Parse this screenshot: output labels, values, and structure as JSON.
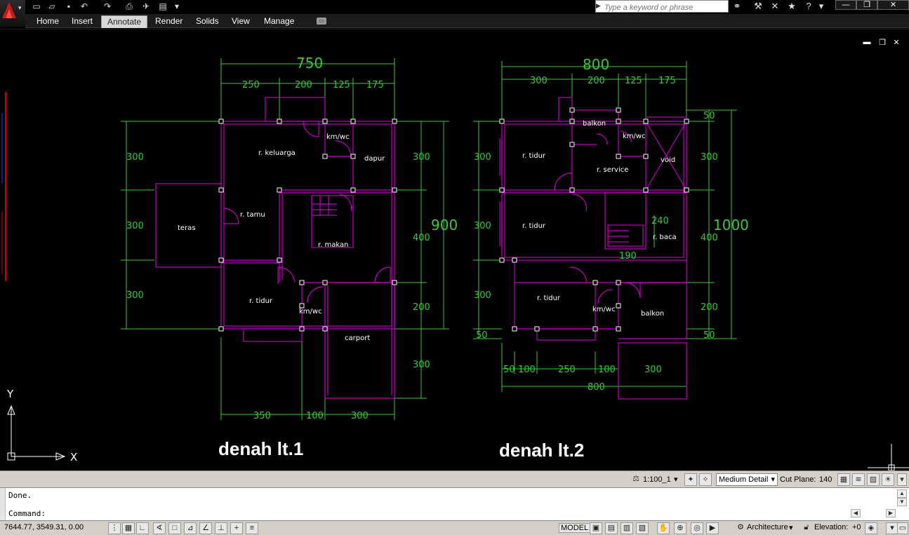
{
  "app": {
    "search_placeholder": "Type a keyword or phrase"
  },
  "ribbon": {
    "tabs": [
      "Home",
      "Insert",
      "Annotate",
      "Render",
      "Solids",
      "View",
      "Manage"
    ],
    "active_tab": "Annotate"
  },
  "plan1": {
    "title": "denah lt.1",
    "rooms": [
      "r. keluarga",
      "km/wc",
      "dapur",
      "r. tamu",
      "teras",
      "r. makan",
      "r. tidur",
      "km/wc",
      "carport"
    ],
    "dims_top": [
      "750",
      "250",
      "200",
      "125",
      "175"
    ],
    "dims_left": [
      "300",
      "300",
      "300"
    ],
    "dims_right": [
      "300",
      "400",
      "200",
      "300"
    ],
    "dim_right_total": "900",
    "dims_bottom": [
      "350",
      "100",
      "300"
    ]
  },
  "plan2": {
    "title": "denah lt.2",
    "rooms": [
      "balkon",
      "km/wc",
      "r. tidur",
      "r. service",
      "void",
      "r. tidur",
      "r. baca",
      "r. tidur",
      "km/wc",
      "balkon"
    ],
    "dims_top": [
      "800",
      "300",
      "200",
      "125",
      "175"
    ],
    "dims_left": [
      "300",
      "300",
      "300",
      "50"
    ],
    "dims_right": [
      "50",
      "300",
      "400",
      "200",
      "50"
    ],
    "dim_right_total": "1000",
    "dims_inner": [
      "240",
      "190"
    ],
    "dims_bottom": [
      "50",
      "100",
      "250",
      "100",
      "300"
    ],
    "dim_bottom_total": "800"
  },
  "ucs": {
    "x_label": "X",
    "y_label": "Y"
  },
  "drawbar": {
    "scale": "1:100_1",
    "detail_level": "Medium Detail",
    "cut_plane_label": "Cut Plane:",
    "cut_plane_value": "140"
  },
  "command": {
    "history": "Done.",
    "prompt": "Command:"
  },
  "status": {
    "coordinates": "7644.77, 3549.31, 0.00",
    "model_label": "MODEL",
    "workspace": "Architecture",
    "elevation_label": "Elevation:",
    "elevation_value": "+0"
  },
  "colors": {
    "wall": "#c000c0",
    "dimension": "#3cc83c",
    "background": "#000000"
  }
}
